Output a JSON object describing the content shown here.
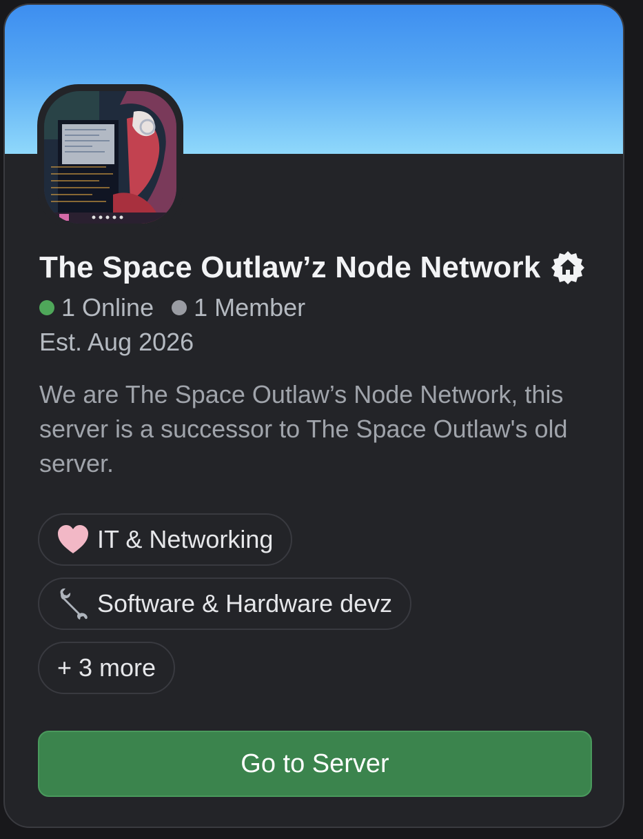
{
  "server": {
    "name": "The Space Outlaw’z Node Network",
    "online_count_label": "1 Online",
    "member_count_label": "1 Member",
    "established": "Est. Aug 2026",
    "description": "We are The Space Outlaw’s Node Network, this server is a successor to The Space Outlaw's old server."
  },
  "tags": [
    {
      "label": "IT & Networking",
      "icon": "heart-emoji"
    },
    {
      "label": "Software & Hardware devz",
      "icon": "wrench-emoji"
    },
    {
      "label": "+ 3 more"
    }
  ],
  "actions": {
    "go_to_server": "Go to Server"
  },
  "colors": {
    "online": "#4fa75a",
    "member": "#9a9ca3",
    "cta": "#3b844d",
    "banner_top": "#3d8ef0",
    "banner_bottom": "#8fd8fb"
  }
}
